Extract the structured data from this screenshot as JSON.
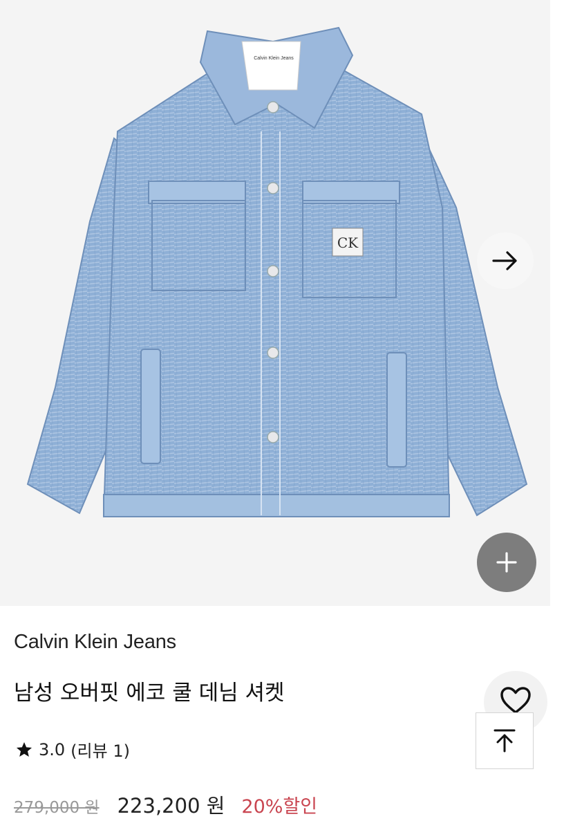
{
  "product": {
    "brand": "Calvin Klein Jeans",
    "name": "남성 오버핏 에코 쿨 데님 셔켓",
    "rating": "3.0",
    "reviews": "(리뷰 1)",
    "original_price": "279,000 원",
    "sale_price": "223,200 원",
    "discount": "20%할인"
  },
  "image": {
    "label_text": "Calvin Klein Jeans",
    "patch_text": "CK"
  },
  "icons": {
    "next": "arrow-right-icon",
    "zoom": "plus-icon",
    "wish": "heart-icon",
    "top": "arrow-up-to-top-icon",
    "star": "star-icon"
  },
  "colors": {
    "discount": "#c94550",
    "denim": "#8fb0d6",
    "zoom_button": "#7d7d7d"
  }
}
